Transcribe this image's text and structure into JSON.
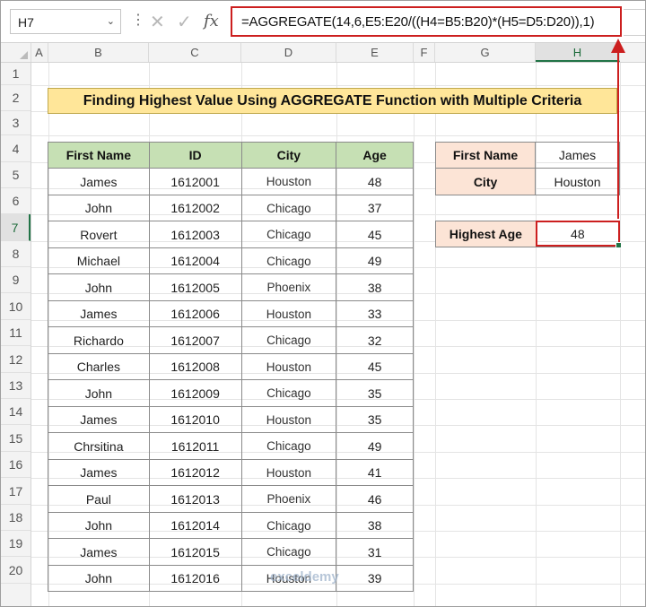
{
  "formula_bar": {
    "name_box": "H7",
    "formula": "=AGGREGATE(14,6,E5:E20/((H4=B5:B20)*(H5=D5:D20)),1)"
  },
  "columns": [
    "A",
    "B",
    "C",
    "D",
    "E",
    "F",
    "G",
    "H"
  ],
  "rows": [
    "1",
    "2",
    "3",
    "4",
    "5",
    "6",
    "7",
    "8",
    "9",
    "10",
    "11",
    "12",
    "13",
    "14",
    "15",
    "16",
    "17",
    "18",
    "19",
    "20"
  ],
  "title": "Finding Highest Value Using AGGREGATE Function with Multiple Criteria",
  "table": {
    "headers": [
      "First Name",
      "ID",
      "City",
      "Age"
    ],
    "rows": [
      [
        "James",
        "1612001",
        "Houston",
        "48"
      ],
      [
        "John",
        "1612002",
        "Chicago",
        "37"
      ],
      [
        "Rovert",
        "1612003",
        "Chicago",
        "45"
      ],
      [
        "Michael",
        "1612004",
        "Chicago",
        "49"
      ],
      [
        "John",
        "1612005",
        "Phoenix",
        "38"
      ],
      [
        "James",
        "1612006",
        "Houston",
        "33"
      ],
      [
        "Richardo",
        "1612007",
        "Chicago",
        "32"
      ],
      [
        "Charles",
        "1612008",
        "Houston",
        "45"
      ],
      [
        "John",
        "1612009",
        "Chicago",
        "35"
      ],
      [
        "James",
        "1612010",
        "Houston",
        "35"
      ],
      [
        "Chrsitina",
        "1612011",
        "Chicago",
        "49"
      ],
      [
        "James",
        "1612012",
        "Houston",
        "41"
      ],
      [
        "Paul",
        "1612013",
        "Phoenix",
        "46"
      ],
      [
        "John",
        "1612014",
        "Chicago",
        "38"
      ],
      [
        "James",
        "1612015",
        "Chicago",
        "31"
      ],
      [
        "John",
        "1612016",
        "Houston",
        "39"
      ]
    ]
  },
  "criteria": {
    "first_name_label": "First Name",
    "first_name_value": "James",
    "city_label": "City",
    "city_value": "Houston"
  },
  "result": {
    "label": "Highest Age",
    "value": "48"
  },
  "watermark": "exceldemy",
  "colors": {
    "header_green": "#c6e0b4",
    "title_yellow": "#ffe699",
    "label_peach": "#fce4d6",
    "highlight_red": "#cc1f1f"
  }
}
